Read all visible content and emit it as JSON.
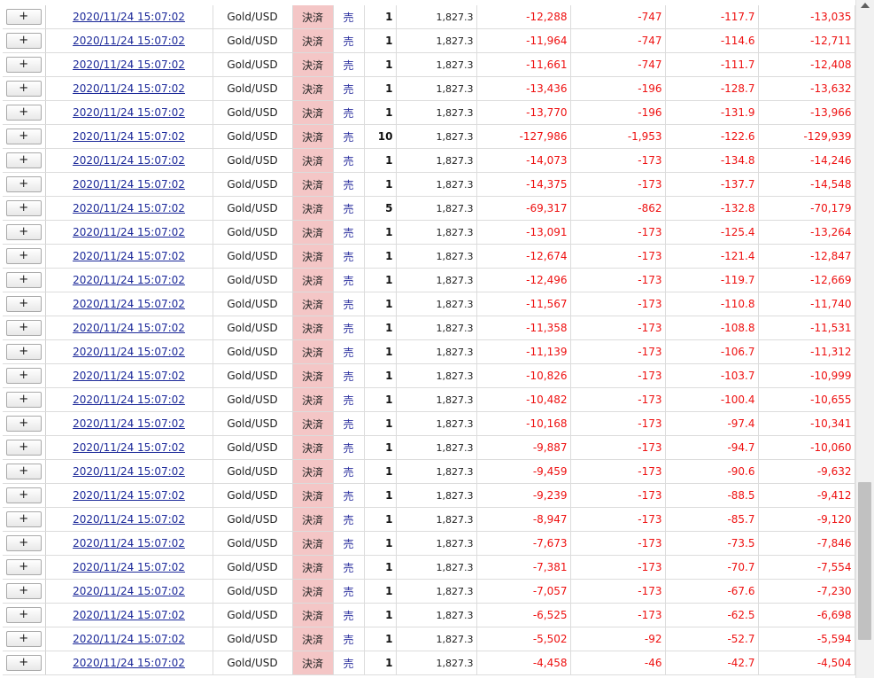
{
  "rows": [
    {
      "expand": "+",
      "datetime": "2020/11/24 15:07:02",
      "symbol": "Gold/USD",
      "type": "決済",
      "side": "売",
      "qty": "1",
      "price": "1,827.3",
      "pl1": "-12,288",
      "pl2": "-747",
      "pl3": "-117.7",
      "total": "-13,035"
    },
    {
      "expand": "+",
      "datetime": "2020/11/24 15:07:02",
      "symbol": "Gold/USD",
      "type": "決済",
      "side": "売",
      "qty": "1",
      "price": "1,827.3",
      "pl1": "-11,964",
      "pl2": "-747",
      "pl3": "-114.6",
      "total": "-12,711"
    },
    {
      "expand": "+",
      "datetime": "2020/11/24 15:07:02",
      "symbol": "Gold/USD",
      "type": "決済",
      "side": "売",
      "qty": "1",
      "price": "1,827.3",
      "pl1": "-11,661",
      "pl2": "-747",
      "pl3": "-111.7",
      "total": "-12,408"
    },
    {
      "expand": "+",
      "datetime": "2020/11/24 15:07:02",
      "symbol": "Gold/USD",
      "type": "決済",
      "side": "売",
      "qty": "1",
      "price": "1,827.3",
      "pl1": "-13,436",
      "pl2": "-196",
      "pl3": "-128.7",
      "total": "-13,632"
    },
    {
      "expand": "+",
      "datetime": "2020/11/24 15:07:02",
      "symbol": "Gold/USD",
      "type": "決済",
      "side": "売",
      "qty": "1",
      "price": "1,827.3",
      "pl1": "-13,770",
      "pl2": "-196",
      "pl3": "-131.9",
      "total": "-13,966"
    },
    {
      "expand": "+",
      "datetime": "2020/11/24 15:07:02",
      "symbol": "Gold/USD",
      "type": "決済",
      "side": "売",
      "qty": "10",
      "price": "1,827.3",
      "pl1": "-127,986",
      "pl2": "-1,953",
      "pl3": "-122.6",
      "total": "-129,939"
    },
    {
      "expand": "+",
      "datetime": "2020/11/24 15:07:02",
      "symbol": "Gold/USD",
      "type": "決済",
      "side": "売",
      "qty": "1",
      "price": "1,827.3",
      "pl1": "-14,073",
      "pl2": "-173",
      "pl3": "-134.8",
      "total": "-14,246"
    },
    {
      "expand": "+",
      "datetime": "2020/11/24 15:07:02",
      "symbol": "Gold/USD",
      "type": "決済",
      "side": "売",
      "qty": "1",
      "price": "1,827.3",
      "pl1": "-14,375",
      "pl2": "-173",
      "pl3": "-137.7",
      "total": "-14,548"
    },
    {
      "expand": "+",
      "datetime": "2020/11/24 15:07:02",
      "symbol": "Gold/USD",
      "type": "決済",
      "side": "売",
      "qty": "5",
      "price": "1,827.3",
      "pl1": "-69,317",
      "pl2": "-862",
      "pl3": "-132.8",
      "total": "-70,179"
    },
    {
      "expand": "+",
      "datetime": "2020/11/24 15:07:02",
      "symbol": "Gold/USD",
      "type": "決済",
      "side": "売",
      "qty": "1",
      "price": "1,827.3",
      "pl1": "-13,091",
      "pl2": "-173",
      "pl3": "-125.4",
      "total": "-13,264"
    },
    {
      "expand": "+",
      "datetime": "2020/11/24 15:07:02",
      "symbol": "Gold/USD",
      "type": "決済",
      "side": "売",
      "qty": "1",
      "price": "1,827.3",
      "pl1": "-12,674",
      "pl2": "-173",
      "pl3": "-121.4",
      "total": "-12,847"
    },
    {
      "expand": "+",
      "datetime": "2020/11/24 15:07:02",
      "symbol": "Gold/USD",
      "type": "決済",
      "side": "売",
      "qty": "1",
      "price": "1,827.3",
      "pl1": "-12,496",
      "pl2": "-173",
      "pl3": "-119.7",
      "total": "-12,669"
    },
    {
      "expand": "+",
      "datetime": "2020/11/24 15:07:02",
      "symbol": "Gold/USD",
      "type": "決済",
      "side": "売",
      "qty": "1",
      "price": "1,827.3",
      "pl1": "-11,567",
      "pl2": "-173",
      "pl3": "-110.8",
      "total": "-11,740"
    },
    {
      "expand": "+",
      "datetime": "2020/11/24 15:07:02",
      "symbol": "Gold/USD",
      "type": "決済",
      "side": "売",
      "qty": "1",
      "price": "1,827.3",
      "pl1": "-11,358",
      "pl2": "-173",
      "pl3": "-108.8",
      "total": "-11,531"
    },
    {
      "expand": "+",
      "datetime": "2020/11/24 15:07:02",
      "symbol": "Gold/USD",
      "type": "決済",
      "side": "売",
      "qty": "1",
      "price": "1,827.3",
      "pl1": "-11,139",
      "pl2": "-173",
      "pl3": "-106.7",
      "total": "-11,312"
    },
    {
      "expand": "+",
      "datetime": "2020/11/24 15:07:02",
      "symbol": "Gold/USD",
      "type": "決済",
      "side": "売",
      "qty": "1",
      "price": "1,827.3",
      "pl1": "-10,826",
      "pl2": "-173",
      "pl3": "-103.7",
      "total": "-10,999"
    },
    {
      "expand": "+",
      "datetime": "2020/11/24 15:07:02",
      "symbol": "Gold/USD",
      "type": "決済",
      "side": "売",
      "qty": "1",
      "price": "1,827.3",
      "pl1": "-10,482",
      "pl2": "-173",
      "pl3": "-100.4",
      "total": "-10,655"
    },
    {
      "expand": "+",
      "datetime": "2020/11/24 15:07:02",
      "symbol": "Gold/USD",
      "type": "決済",
      "side": "売",
      "qty": "1",
      "price": "1,827.3",
      "pl1": "-10,168",
      "pl2": "-173",
      "pl3": "-97.4",
      "total": "-10,341"
    },
    {
      "expand": "+",
      "datetime": "2020/11/24 15:07:02",
      "symbol": "Gold/USD",
      "type": "決済",
      "side": "売",
      "qty": "1",
      "price": "1,827.3",
      "pl1": "-9,887",
      "pl2": "-173",
      "pl3": "-94.7",
      "total": "-10,060"
    },
    {
      "expand": "+",
      "datetime": "2020/11/24 15:07:02",
      "symbol": "Gold/USD",
      "type": "決済",
      "side": "売",
      "qty": "1",
      "price": "1,827.3",
      "pl1": "-9,459",
      "pl2": "-173",
      "pl3": "-90.6",
      "total": "-9,632"
    },
    {
      "expand": "+",
      "datetime": "2020/11/24 15:07:02",
      "symbol": "Gold/USD",
      "type": "決済",
      "side": "売",
      "qty": "1",
      "price": "1,827.3",
      "pl1": "-9,239",
      "pl2": "-173",
      "pl3": "-88.5",
      "total": "-9,412"
    },
    {
      "expand": "+",
      "datetime": "2020/11/24 15:07:02",
      "symbol": "Gold/USD",
      "type": "決済",
      "side": "売",
      "qty": "1",
      "price": "1,827.3",
      "pl1": "-8,947",
      "pl2": "-173",
      "pl3": "-85.7",
      "total": "-9,120"
    },
    {
      "expand": "+",
      "datetime": "2020/11/24 15:07:02",
      "symbol": "Gold/USD",
      "type": "決済",
      "side": "売",
      "qty": "1",
      "price": "1,827.3",
      "pl1": "-7,673",
      "pl2": "-173",
      "pl3": "-73.5",
      "total": "-7,846"
    },
    {
      "expand": "+",
      "datetime": "2020/11/24 15:07:02",
      "symbol": "Gold/USD",
      "type": "決済",
      "side": "売",
      "qty": "1",
      "price": "1,827.3",
      "pl1": "-7,381",
      "pl2": "-173",
      "pl3": "-70.7",
      "total": "-7,554"
    },
    {
      "expand": "+",
      "datetime": "2020/11/24 15:07:02",
      "symbol": "Gold/USD",
      "type": "決済",
      "side": "売",
      "qty": "1",
      "price": "1,827.3",
      "pl1": "-7,057",
      "pl2": "-173",
      "pl3": "-67.6",
      "total": "-7,230"
    },
    {
      "expand": "+",
      "datetime": "2020/11/24 15:07:02",
      "symbol": "Gold/USD",
      "type": "決済",
      "side": "売",
      "qty": "1",
      "price": "1,827.3",
      "pl1": "-6,525",
      "pl2": "-173",
      "pl3": "-62.5",
      "total": "-6,698"
    },
    {
      "expand": "+",
      "datetime": "2020/11/24 15:07:02",
      "symbol": "Gold/USD",
      "type": "決済",
      "side": "売",
      "qty": "1",
      "price": "1,827.3",
      "pl1": "-5,502",
      "pl2": "-92",
      "pl3": "-52.7",
      "total": "-5,594"
    },
    {
      "expand": "+",
      "datetime": "2020/11/24 15:07:02",
      "symbol": "Gold/USD",
      "type": "決済",
      "side": "売",
      "qty": "1",
      "price": "1,827.3",
      "pl1": "-4,458",
      "pl2": "-46",
      "pl3": "-42.7",
      "total": "-4,504"
    }
  ]
}
